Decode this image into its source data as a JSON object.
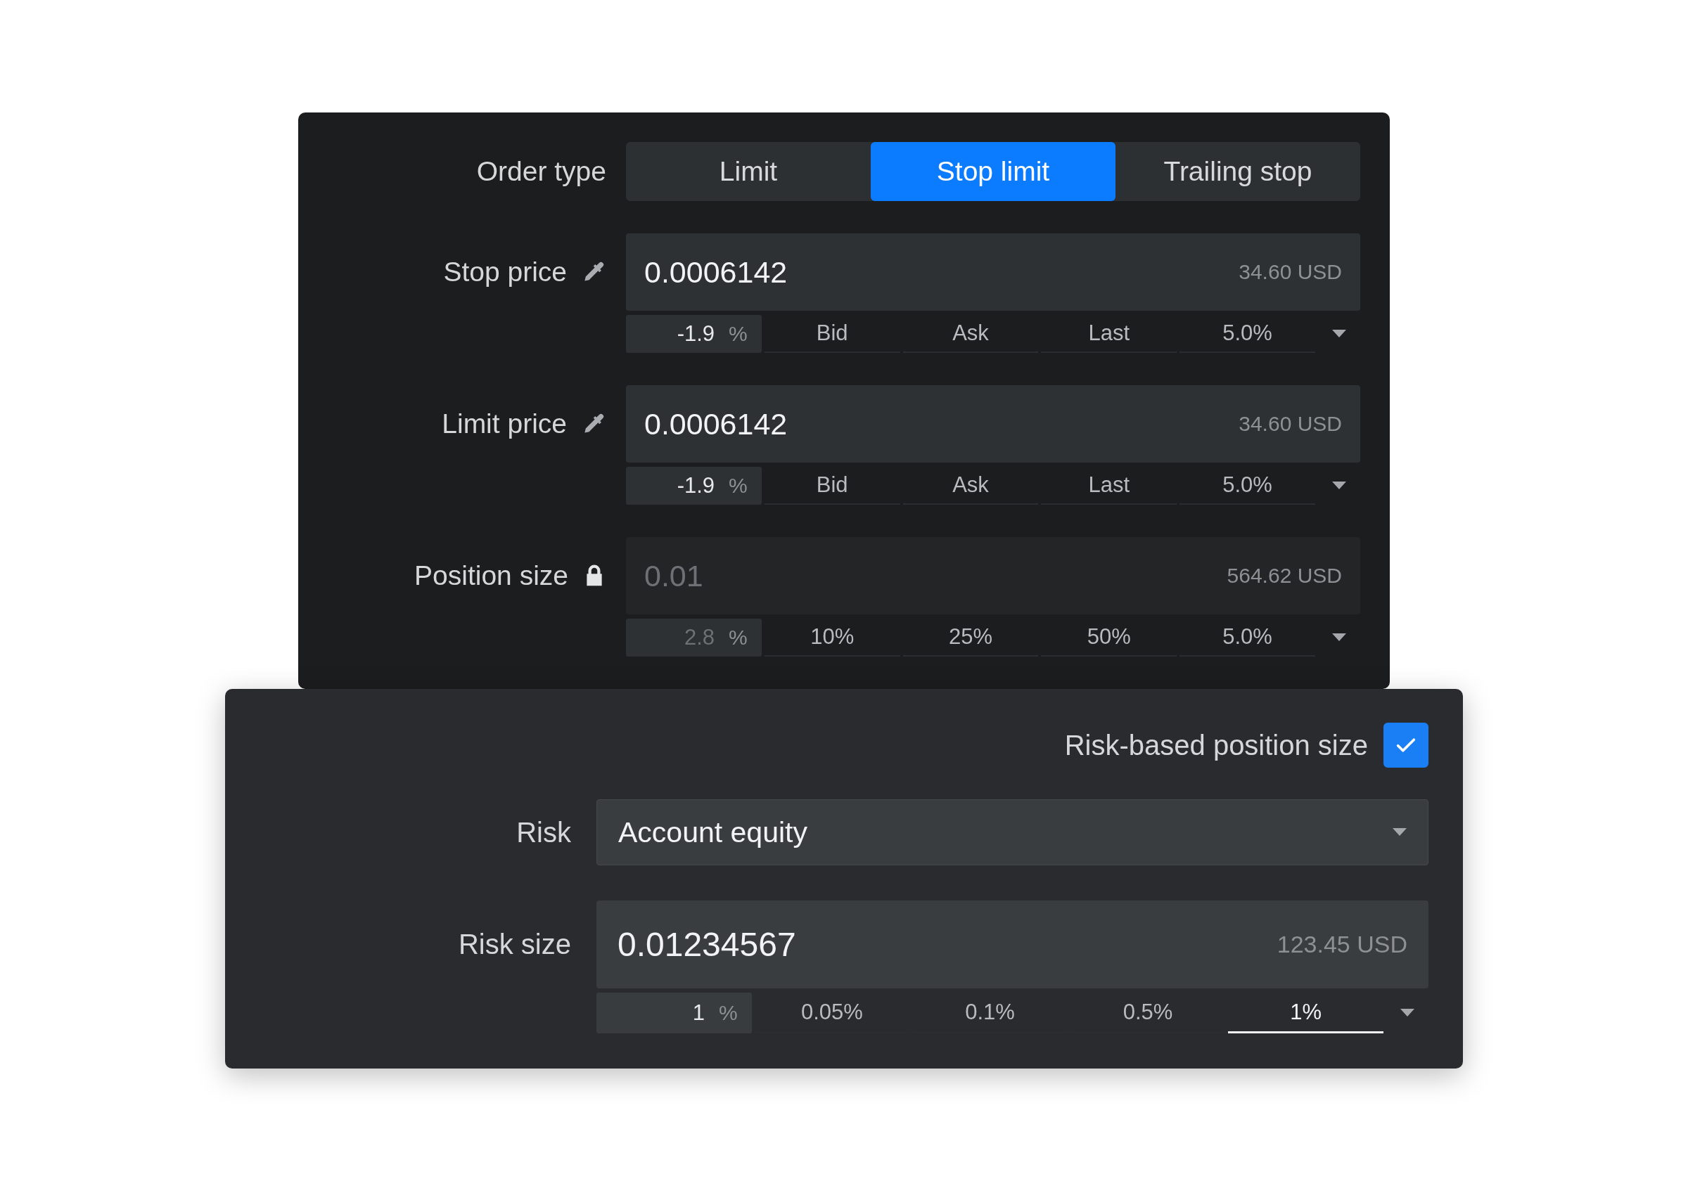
{
  "order_form": {
    "order_type": {
      "label": "Order type",
      "tabs": [
        {
          "label": "Limit",
          "selected": false
        },
        {
          "label": "Stop limit",
          "selected": true
        },
        {
          "label": "Trailing stop",
          "selected": false
        }
      ]
    },
    "fields": [
      {
        "label": "Stop price",
        "kind": "picker",
        "disabled": false,
        "value": "0.0006142",
        "converted": "34.60 USD",
        "percent": "-1.9",
        "unit": "%",
        "options": [
          {
            "label": "Bid",
            "selected": false
          },
          {
            "label": "Ask",
            "selected": false
          },
          {
            "label": "Last",
            "selected": false
          },
          {
            "label": "5.0%",
            "selected": false
          }
        ]
      },
      {
        "label": "Limit price",
        "kind": "picker",
        "disabled": false,
        "value": "0.0006142",
        "converted": "34.60 USD",
        "percent": "-1.9",
        "unit": "%",
        "options": [
          {
            "label": "Bid",
            "selected": false
          },
          {
            "label": "Ask",
            "selected": false
          },
          {
            "label": "Last",
            "selected": false
          },
          {
            "label": "5.0%",
            "selected": false
          }
        ]
      },
      {
        "label": "Position size",
        "kind": "locked",
        "disabled": true,
        "value": "0.01",
        "converted": "564.62 USD",
        "percent": "2.8",
        "unit": "%",
        "options": [
          {
            "label": "10%",
            "selected": false
          },
          {
            "label": "25%",
            "selected": false
          },
          {
            "label": "50%",
            "selected": false
          },
          {
            "label": "5.0%",
            "selected": false
          }
        ]
      }
    ]
  },
  "risk_panel": {
    "risk_based": {
      "label": "Risk-based position size",
      "checked": true
    },
    "risk": {
      "label": "Risk",
      "value": "Account equity"
    },
    "risk_size": {
      "label": "Risk size",
      "disabled": false,
      "value": "0.01234567",
      "converted": "123.45 USD",
      "percent": "1",
      "unit": "%",
      "options": [
        {
          "label": "0.05%",
          "selected": false
        },
        {
          "label": "0.1%",
          "selected": false
        },
        {
          "label": "0.5%",
          "selected": false
        },
        {
          "label": "1%",
          "selected": true
        }
      ]
    }
  }
}
